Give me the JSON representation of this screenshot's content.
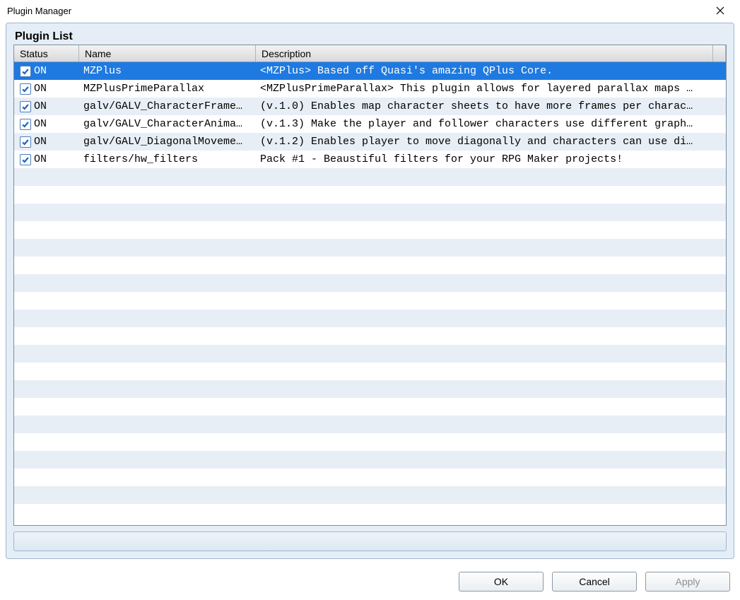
{
  "window": {
    "title": "Plugin Manager"
  },
  "section": {
    "title": "Plugin List"
  },
  "columns": {
    "status": "Status",
    "name": "Name",
    "description": "Description"
  },
  "status_on": "ON",
  "plugins": [
    {
      "name": "MZPlus",
      "description": "<MZPlus> Based off Quasi's amazing QPlus Core.",
      "checked": true,
      "selected": true
    },
    {
      "name": "MZPlusPrimeParallax",
      "description": "<MZPlusPrimeParallax> This plugin allows for layered parallax maps …",
      "checked": true,
      "selected": false
    },
    {
      "name": "galv/GALV_CharacterFrame…",
      "description": "(v.1.0) Enables map character sheets to have more frames per charac…",
      "checked": true,
      "selected": false
    },
    {
      "name": "galv/GALV_CharacterAnima…",
      "description": "(v.1.3) Make the player and follower characters use different graph…",
      "checked": true,
      "selected": false
    },
    {
      "name": "galv/GALV_DiagonalMoveme…",
      "description": "(v.1.2) Enables player to move diagonally and characters can use di…",
      "checked": true,
      "selected": false
    },
    {
      "name": "filters/hw_filters",
      "description": "Pack #1 - Beaustiful filters for your RPG Maker projects!",
      "checked": true,
      "selected": false
    }
  ],
  "empty_rows": 20,
  "buttons": {
    "ok": "OK",
    "cancel": "Cancel",
    "apply": "Apply"
  }
}
